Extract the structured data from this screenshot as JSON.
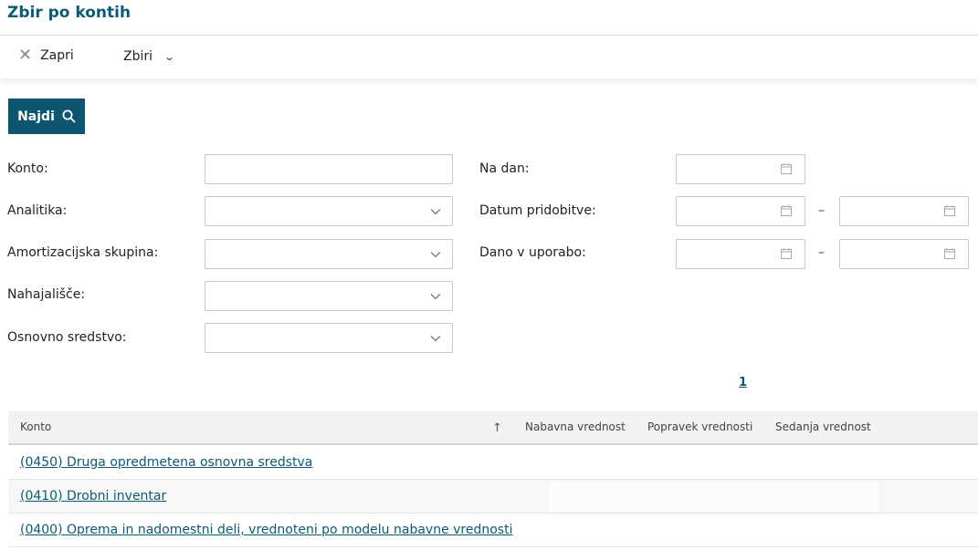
{
  "header": {
    "title": "Zbir po kontih"
  },
  "toolbar": {
    "close_label": "Zapri",
    "close_icon": "close-icon",
    "zbiri_label": "Zbiri",
    "zbiri_icon": "chevron-down-icon"
  },
  "search_button": {
    "label": "Najdi",
    "icon": "search-icon",
    "color": "#0c5670"
  },
  "filters": {
    "konto": {
      "label": "Konto:",
      "value": ""
    },
    "analitika": {
      "label": "Analitika:",
      "value": ""
    },
    "amortizacijska_skupina": {
      "label": "Amortizacijska skupina:",
      "value": ""
    },
    "nahajalisce": {
      "label": "Nahajališče:",
      "value": ""
    },
    "osnovno_sredstvo": {
      "label": "Osnovno sredstvo:",
      "value": ""
    },
    "na_dan": {
      "label": "Na dan:",
      "value": ""
    },
    "datum_pridobitve": {
      "label": "Datum pridobitve:",
      "from": "",
      "to": "",
      "separator": "–"
    },
    "dano_v_uporabo": {
      "label": "Dano v uporabo:",
      "from": "",
      "to": "",
      "separator": "–"
    }
  },
  "pagination": {
    "current_page": "1"
  },
  "table": {
    "columns": [
      "Konto",
      "Nabavna vrednost",
      "Popravek vrednosti",
      "Sedanja vrednost"
    ],
    "sort_indicator": "↑",
    "rows": [
      {
        "konto": "(0450) Druga opredmetena osnovna sredstva"
      },
      {
        "konto": "(0410) Drobni inventar"
      },
      {
        "konto": "(0400) Oprema in nadomestni deli, vrednoteni po modelu nabavne vrednosti"
      }
    ]
  },
  "colors": {
    "accent": "#0b5a78",
    "button": "#0c5670"
  }
}
